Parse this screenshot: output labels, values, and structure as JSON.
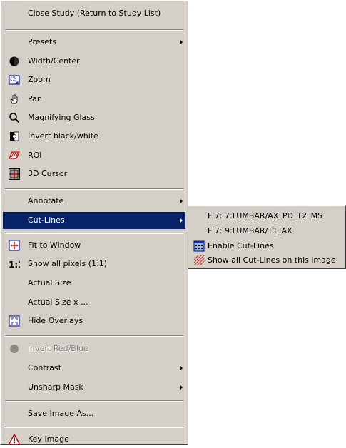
{
  "main_menu": {
    "close_study": "Close Study (Return to Study List)",
    "presets": "Presets",
    "width_center": "Width/Center",
    "zoom": "Zoom",
    "pan": "Pan",
    "magnifying_glass": "Magnifying Glass",
    "invert_black_white": "Invert black/white",
    "roi": "ROI",
    "cursor_3d": "3D Cursor",
    "annotate": "Annotate",
    "cut_lines": "Cut-Lines",
    "fit_to_window": "Fit to Window",
    "show_all_pixels": "Show all pixels (1:1)",
    "actual_size": "Actual Size",
    "actual_size_x": "Actual Size x ...",
    "hide_overlays": "Hide Overlays",
    "invert_red_blue": "Invert Red/Blue",
    "contrast": "Contrast",
    "unsharp_mask": "Unsharp Mask",
    "save_image_as": "Save Image As...",
    "key_image": "Key Image"
  },
  "cut_lines_submenu": {
    "series_1": "F 7:  7:LUMBAR/AX_PD_T2_MS",
    "series_2": "F 7:  9:LUMBAR/T1_AX",
    "enable": "Enable Cut-Lines",
    "show_all": "Show all Cut-Lines on this image"
  },
  "icons": {
    "width_center": "half-filled-circle-icon",
    "zoom": "zoom-frame-icon",
    "pan": "hand-icon",
    "magnifying_glass": "magnifier-icon",
    "invert": "invert-square-icon",
    "roi": "roi-icon",
    "cursor_3d": "3d-cursor-icon",
    "fit_to_window": "fit-window-icon",
    "show_all_pixels": "one-to-one-icon",
    "hide_overlays": "overlay-icon",
    "invert_red_blue": "grey-circle-icon",
    "key_image": "warning-triangle-icon",
    "enable_cut_lines": "grid-icon",
    "show_all_cut_lines": "hatched-lines-icon"
  },
  "colors": {
    "menu_bg": "#d4d0c8",
    "highlight": "#0a246a",
    "highlight_text": "#ffffff",
    "disabled_text": "#8c8a84"
  }
}
